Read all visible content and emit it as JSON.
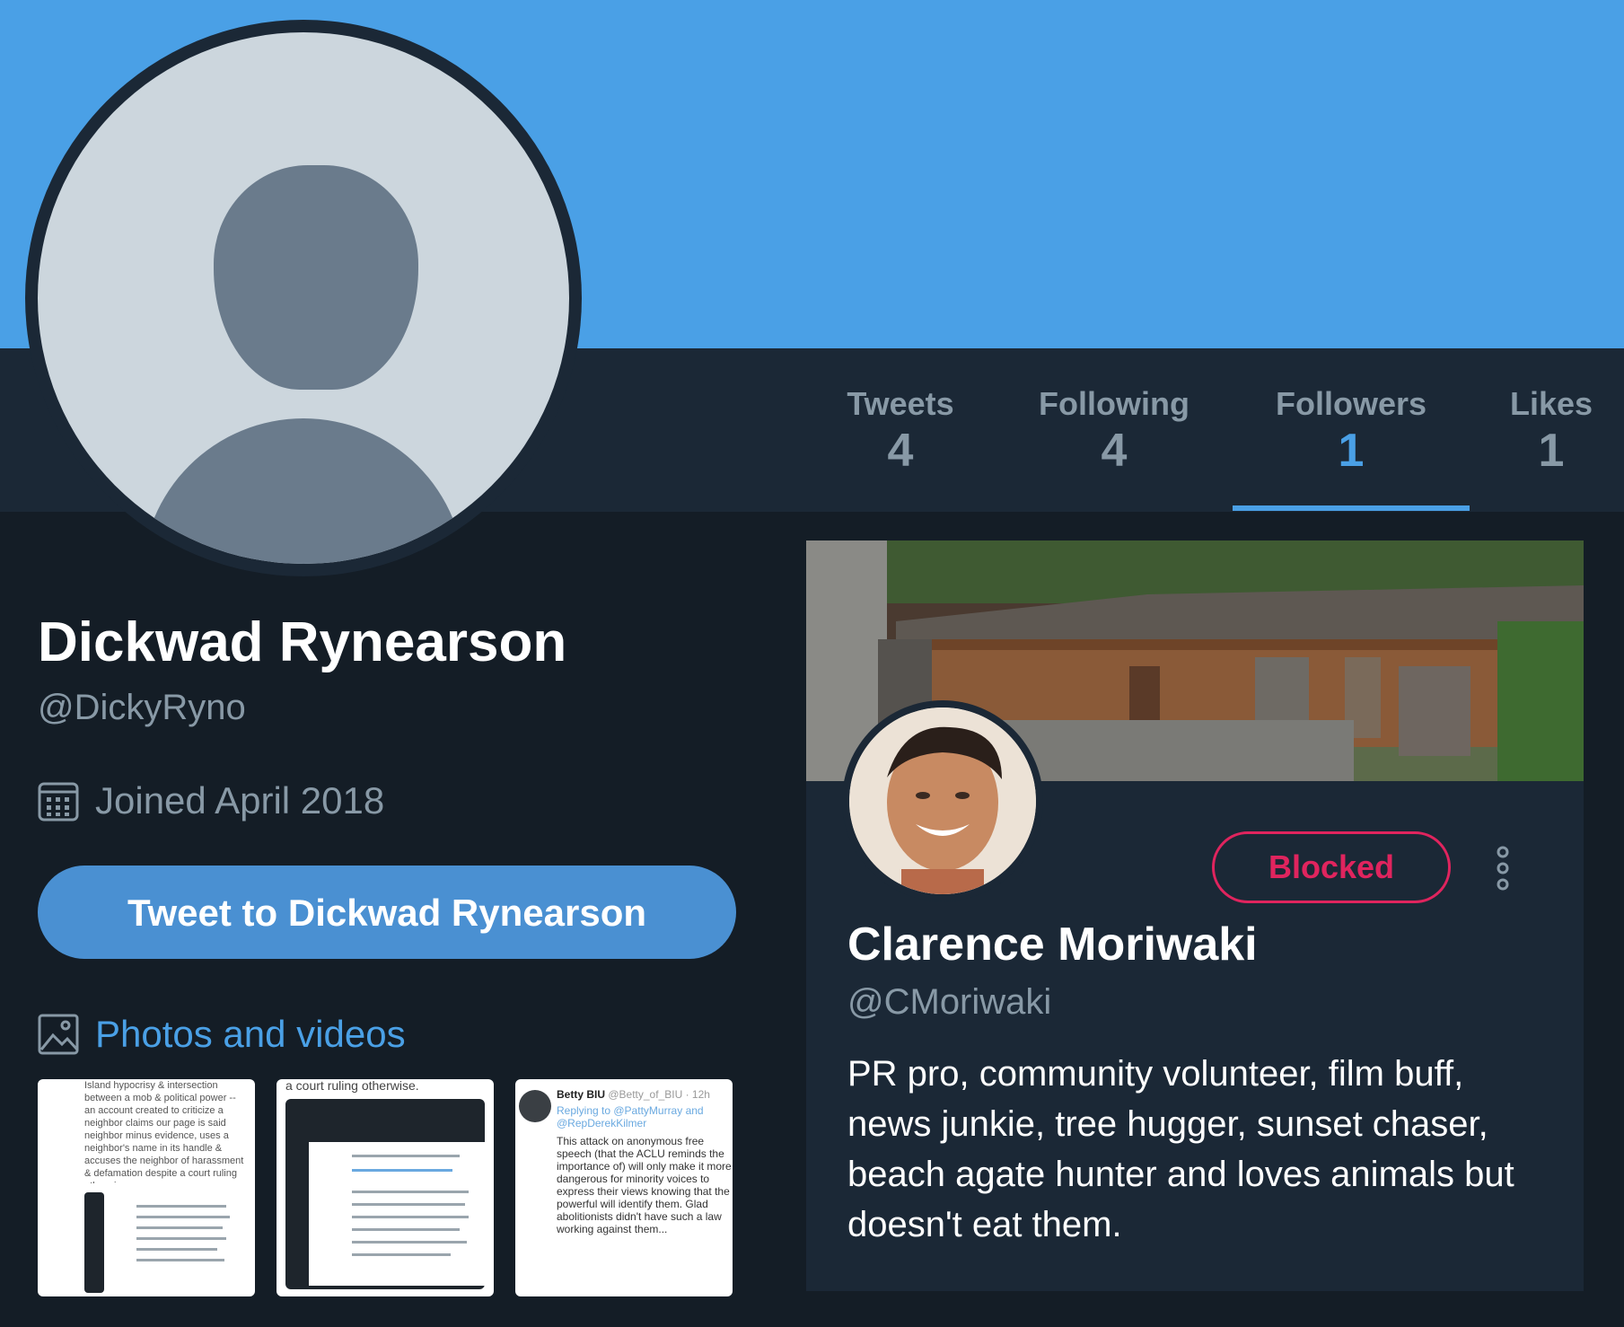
{
  "colors": {
    "banner": "#4aa0e6",
    "nav_bg": "#1b2836",
    "page_bg": "#141d26",
    "accent": "#4aa0e6",
    "blocked": "#e0245e",
    "muted_text": "#8899a6"
  },
  "profile": {
    "name": "Dickwad Rynearson",
    "handle": "@DickyRyno",
    "joined": "Joined April 2018",
    "avatar_icon": "default-avatar-icon"
  },
  "stats": {
    "tweets": {
      "label": "Tweets",
      "value": "4"
    },
    "following": {
      "label": "Following",
      "value": "4"
    },
    "followers": {
      "label": "Followers",
      "value": "1"
    },
    "likes": {
      "label": "Likes",
      "value": "1"
    },
    "active_tab": "Followers"
  },
  "actions": {
    "tweet_to": "Tweet to Dickwad Rynearson"
  },
  "media": {
    "title": "Photos and videos",
    "thumbs": [
      {
        "snippet": "Island hypocrisy & intersection between a mob & political power -- an account created to criticize a neighbor claims our page is said neighbor minus evidence, uses a neighbor's name in its handle & accuses the neighbor of harassment & defamation despite a court ruling otherwise."
      },
      {
        "snippet": "a court ruling otherwise."
      },
      {
        "author": "Betty BIU",
        "author_handle": "@Betty_of_BIU · 12h",
        "replying": "Replying to @PattyMurray and @RepDerekKilmer",
        "snippet": "This attack on anonymous free speech (that the ACLU reminds the importance of) will only make it more dangerous for minority voices to express their views knowing that the powerful will identify them. Glad abolitionists didn't have such a law working against them..."
      }
    ]
  },
  "card": {
    "name": "Clarence Moriwaki",
    "handle": "@CMoriwaki",
    "blocked_label": "Blocked",
    "more_icon": "more-vertical-icon",
    "bio": "PR pro, community volunteer, film buff, news junkie, tree hugger, sunset chaser, beach agate hunter and loves animals but doesn't eat them."
  }
}
